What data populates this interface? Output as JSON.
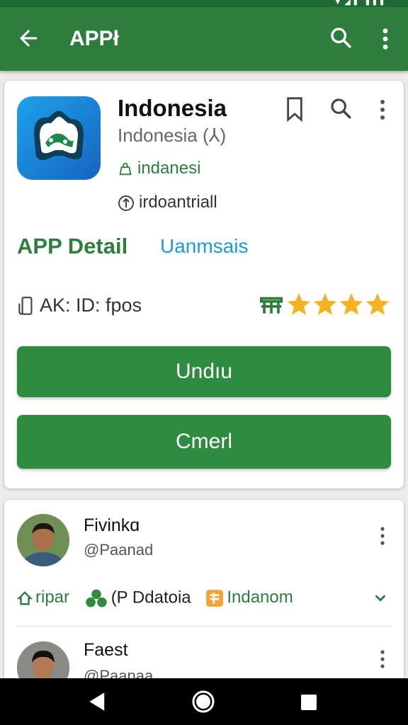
{
  "appbar": {
    "title": "APPł"
  },
  "app": {
    "name": "Indonesia",
    "subtitle": "Indonesia (⅄)",
    "meta1": "indanesi",
    "meta2": "irdoantriall",
    "detail_label": "APP Detail",
    "detail_link": "Uanmsais",
    "id_text": "AK: ID: fpos",
    "rating": 4,
    "rating_max": 5,
    "colors": {
      "accent": "#2e7d3c",
      "star": "#f5b223",
      "star_alt": "#2f9ae8"
    }
  },
  "buttons": {
    "primary": "Undıu",
    "secondary": "Cmerl"
  },
  "posts": [
    {
      "name": "Fivinkɑ",
      "handle": "@Paanad",
      "tags": [
        "ripar",
        "(P Ddatoia",
        "Indanom"
      ]
    },
    {
      "name": "Faest",
      "handle": "@Paanaa"
    }
  ],
  "icons": {
    "appbar": [
      "back-arrow-icon",
      "search-icon",
      "more-vert-icon"
    ],
    "card": [
      "bookmark-icon",
      "search-icon",
      "more-vert-icon"
    ],
    "nav": [
      "nav-back-icon",
      "nav-home-icon",
      "nav-recents-icon"
    ]
  }
}
